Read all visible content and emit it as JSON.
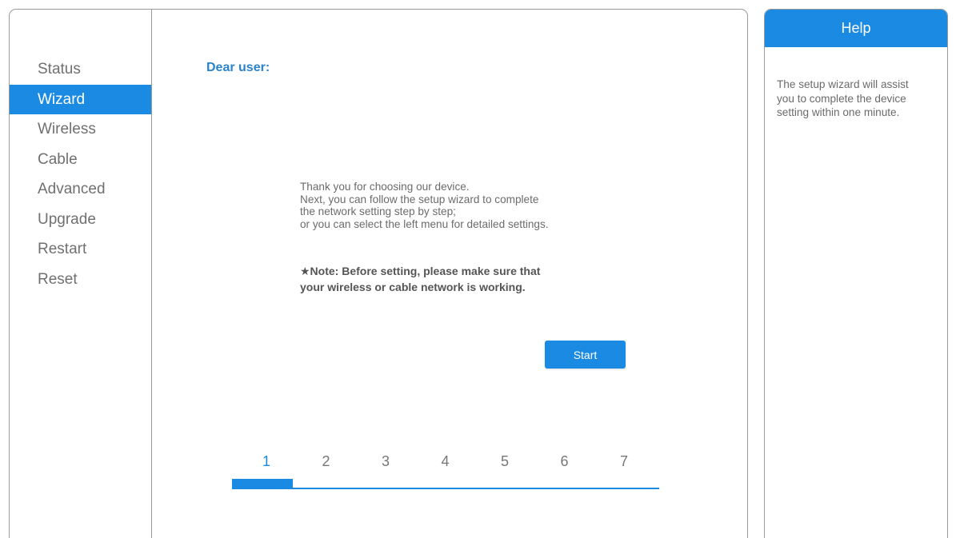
{
  "nav": {
    "items": [
      {
        "label": "Status"
      },
      {
        "label": "Wizard"
      },
      {
        "label": "Wireless"
      },
      {
        "label": "Cable"
      },
      {
        "label": "Advanced"
      },
      {
        "label": "Upgrade"
      },
      {
        "label": "Restart"
      },
      {
        "label": "Reset"
      }
    ],
    "active_index": 1
  },
  "content": {
    "greeting": "Dear user:",
    "intro_lines": [
      "Thank you for choosing our device.",
      "Next, you can follow the setup wizard to complete",
      "the network setting step by step;",
      "or you can select the left menu for detailed settings."
    ],
    "note_lines": [
      "★Note: Before setting, please make sure that",
      "your wireless or cable network is working."
    ],
    "start_label": "Start"
  },
  "steps": {
    "labels": [
      "1",
      "2",
      "3",
      "4",
      "5",
      "6",
      "7"
    ],
    "current": 1,
    "progress_fraction": 0.142
  },
  "help": {
    "title": "Help",
    "lines": [
      "The setup wizard will assist",
      "you to complete the device",
      "setting within one minute."
    ]
  },
  "colors": {
    "accent": "#1b8ae2",
    "greeting": "#2a84cc",
    "text": "#6b6b6b"
  }
}
